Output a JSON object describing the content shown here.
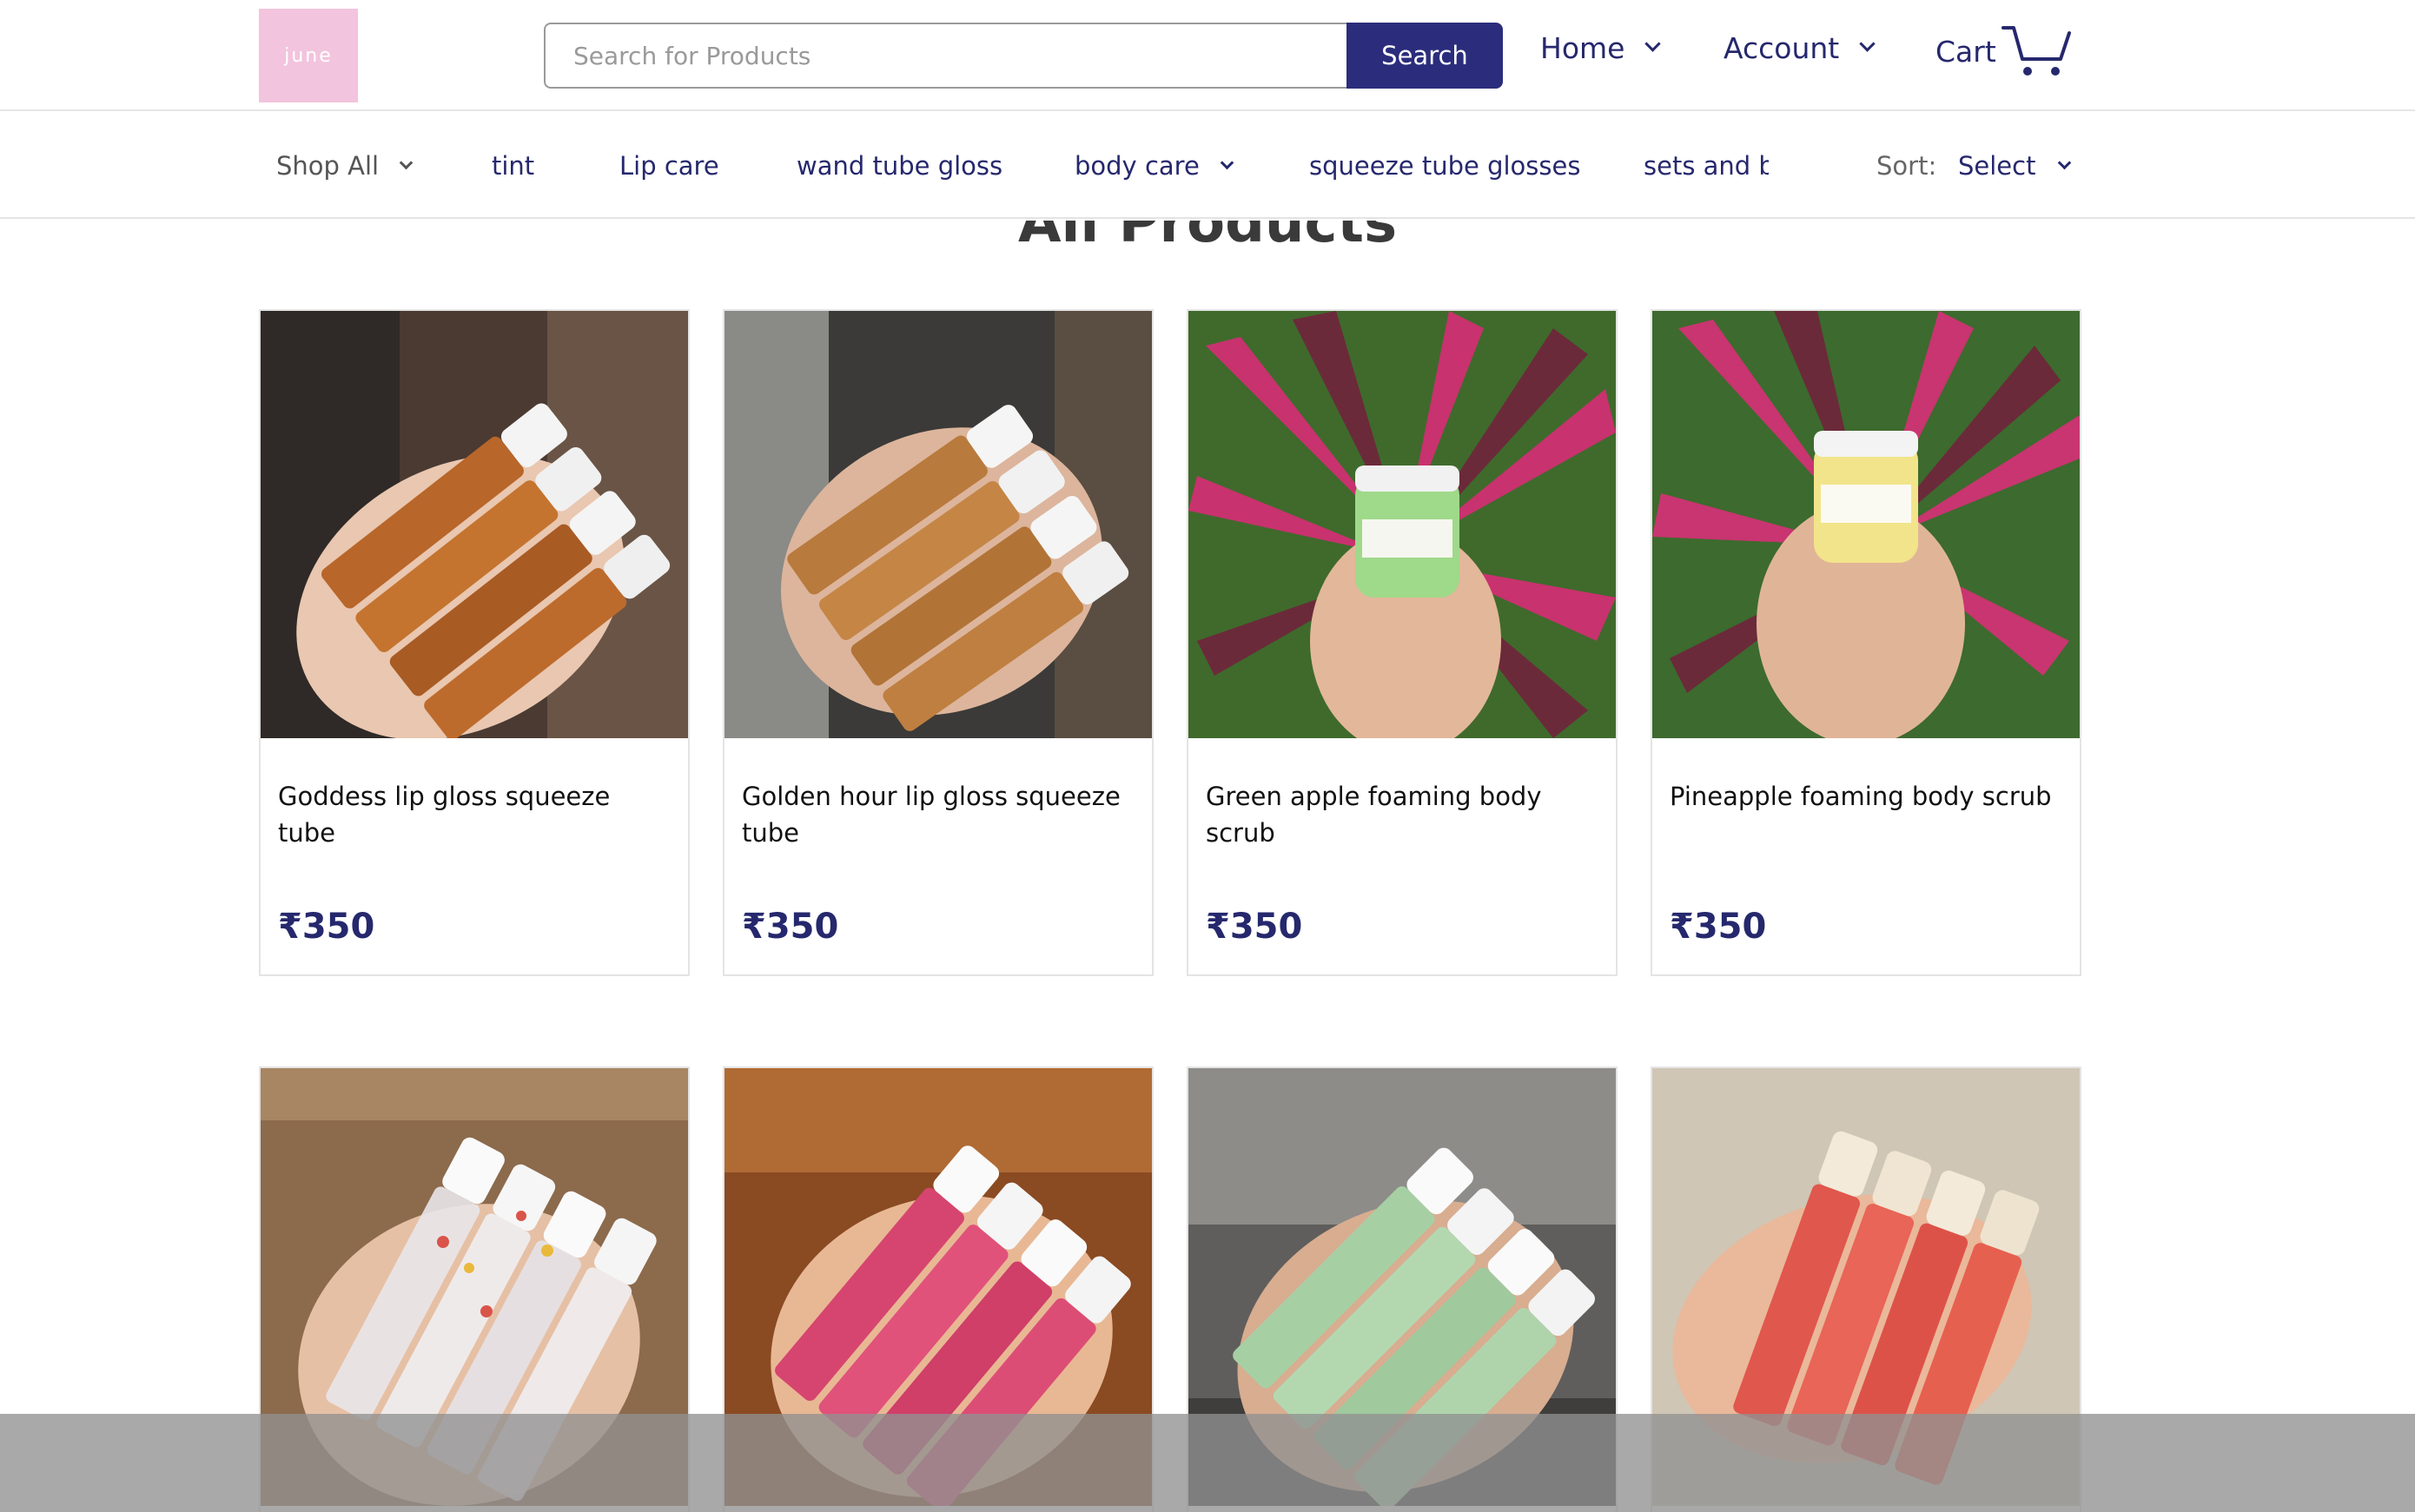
{
  "header": {
    "logo_text": "june",
    "search_placeholder": "Search for Products",
    "search_button": "Search",
    "nav_home": "Home",
    "nav_account": "Account",
    "cart_label": "Cart"
  },
  "categories": {
    "shop_all": "Shop All",
    "tint": "tint",
    "lip_care": "Lip care",
    "wand": "wand tube gloss",
    "body_care": "body care",
    "squeeze": "squeeze tube glosses",
    "sets": "sets and bundles",
    "sort_label": "Sort:",
    "sort_value": "Select"
  },
  "page_title": "All Products",
  "products": [
    {
      "name": "Goddess lip gloss squeeze tube",
      "price": "₹350"
    },
    {
      "name": "Golden hour lip gloss squeeze tube",
      "price": "₹350"
    },
    {
      "name": "Green apple foaming body scrub",
      "price": "₹350"
    },
    {
      "name": "Pineapple foaming body scrub",
      "price": "₹350"
    }
  ],
  "colors": {
    "brand_navy": "#2b2d7c",
    "logo_pink": "#f2c4dd"
  }
}
